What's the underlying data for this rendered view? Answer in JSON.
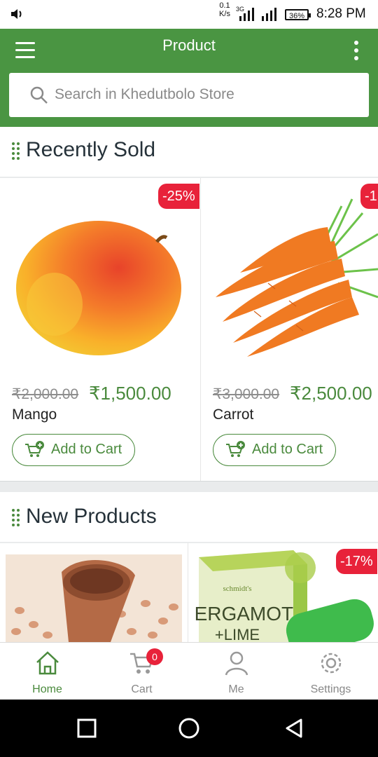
{
  "status_bar": {
    "net_speed_value": "0.1",
    "net_speed_unit": "K/s",
    "network_type": "3G",
    "battery": "36%",
    "time": "8:28 PM"
  },
  "app_bar": {
    "title": "Product",
    "search_placeholder": "Search in Khedutbolo Store"
  },
  "sections": [
    {
      "title": "Recently Sold",
      "products": [
        {
          "name": "Mango",
          "old_price": "₹2,000.00",
          "new_price": "₹1,500.00",
          "discount": "-25%",
          "cart_label": "Add to Cart",
          "image": "mango-image"
        },
        {
          "name": "Carrot",
          "old_price": "₹3,000.00",
          "new_price": "₹2,500.00",
          "discount": "-1",
          "cart_label": "Add to Cart",
          "image": "carrot-image"
        }
      ]
    },
    {
      "title": "New Products",
      "products": [
        {
          "image": "peanuts-pot-image"
        },
        {
          "discount": "-17%",
          "image": "bergamot-lime-box-image",
          "image_text_1": "schmidt's",
          "image_text_2": "BERGAMOT",
          "image_text_3": "+LIME"
        }
      ]
    }
  ],
  "bottom_nav": [
    {
      "label": "Home",
      "icon": "home-icon",
      "active": true
    },
    {
      "label": "Cart",
      "icon": "cart-icon",
      "badge": "0"
    },
    {
      "label": "Me",
      "icon": "person-icon"
    },
    {
      "label": "Settings",
      "icon": "gear-icon"
    }
  ],
  "colors": {
    "primary_green": "#4a9542",
    "price_green": "#4a8a3d",
    "badge_red": "#e8223a"
  }
}
